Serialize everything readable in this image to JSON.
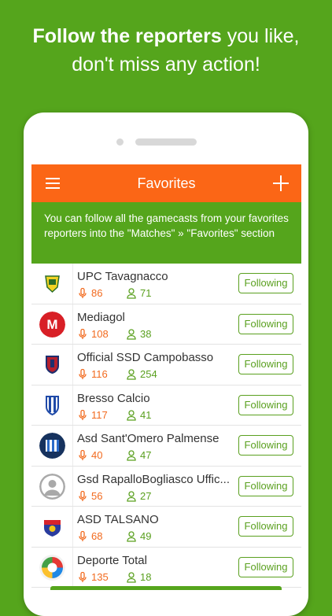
{
  "headline": {
    "bold": "Follow the reporters",
    "rest": " you like,",
    "line2": "don't miss any action!"
  },
  "appbar": {
    "title": "Favorites",
    "menu_icon": "hamburger-icon",
    "add_icon": "plus-icon",
    "color": "#fb6616"
  },
  "banner": {
    "text": "You can follow all the gamecasts from your favorites reporters into the \"Matches\" » \"Favorites\" section"
  },
  "colors": {
    "background": "#55a51c",
    "accent_orange": "#f26a1e",
    "accent_green": "#5aa01f"
  },
  "reporters": [
    {
      "name": "UPC Tavagnacco",
      "mics": "86",
      "followers": "71",
      "button": "Following",
      "crest": "tavagnacco-crest"
    },
    {
      "name": "Mediagol",
      "mics": "108",
      "followers": "38",
      "button": "Following",
      "crest": "mediagol-logo"
    },
    {
      "name": "Official SSD Campobasso",
      "mics": "116",
      "followers": "254",
      "button": "Following",
      "crest": "campobasso-crest"
    },
    {
      "name": "Bresso Calcio",
      "mics": "117",
      "followers": "41",
      "button": "Following",
      "crest": "bresso-crest"
    },
    {
      "name": "Asd Sant'Omero Palmense",
      "mics": "40",
      "followers": "47",
      "button": "Following",
      "crest": "santomero-crest"
    },
    {
      "name": "Gsd RapalloBogliasco Uffic...",
      "mics": "56",
      "followers": "27",
      "button": "Following",
      "crest": "default-avatar"
    },
    {
      "name": "ASD TALSANO",
      "mics": "68",
      "followers": "49",
      "button": "Following",
      "crest": "talsano-crest"
    },
    {
      "name": "Deporte Total",
      "mics": "135",
      "followers": "18",
      "button": "Following",
      "crest": "deportetotal-logo"
    }
  ]
}
